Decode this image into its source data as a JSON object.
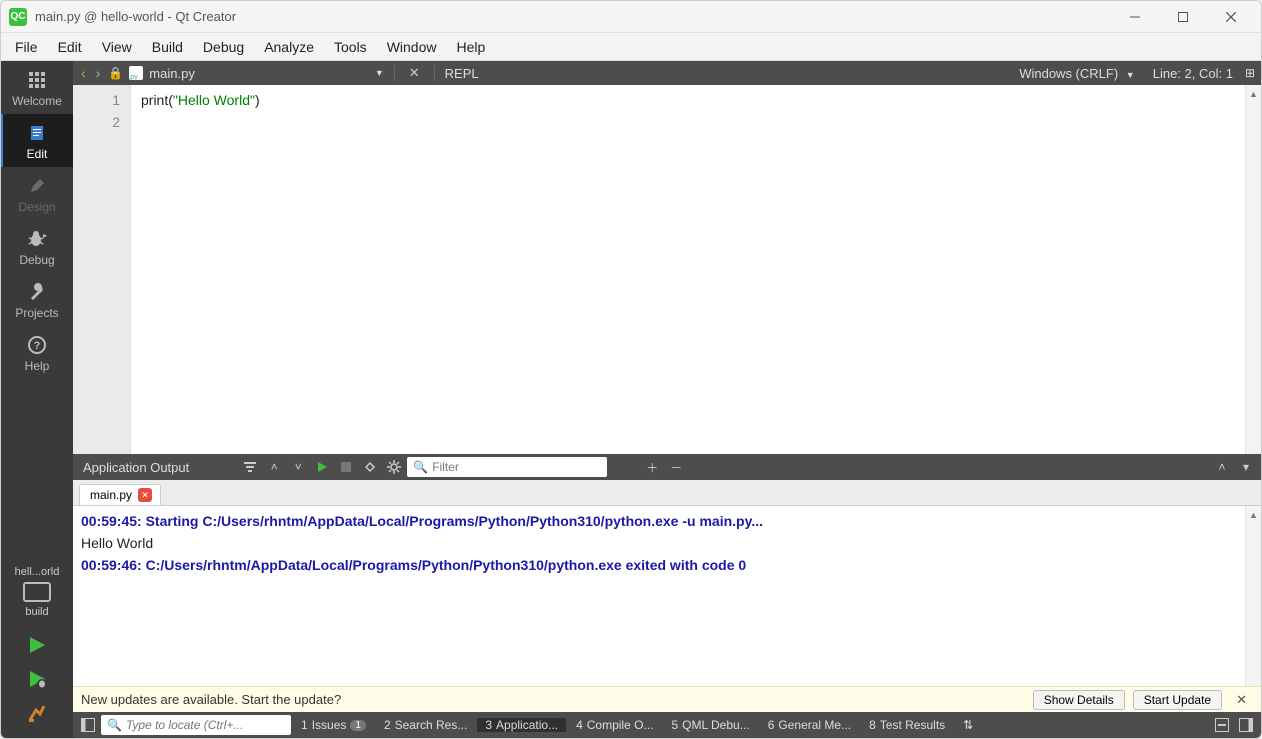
{
  "window": {
    "title": "main.py @ hello-world - Qt Creator",
    "logo_text": "QC"
  },
  "menubar": [
    "File",
    "Edit",
    "View",
    "Build",
    "Debug",
    "Analyze",
    "Tools",
    "Window",
    "Help"
  ],
  "activity": {
    "items": [
      {
        "id": "welcome",
        "label": "Welcome",
        "disabled": false
      },
      {
        "id": "edit",
        "label": "Edit",
        "active": true
      },
      {
        "id": "design",
        "label": "Design",
        "disabled": true
      },
      {
        "id": "debug",
        "label": "Debug"
      },
      {
        "id": "projects",
        "label": "Projects"
      },
      {
        "id": "help",
        "label": "Help"
      }
    ],
    "kit_label_top": "hell...orld",
    "kit_label_bottom": "build"
  },
  "editor_nav": {
    "filename": "main.py",
    "repl_label": "REPL",
    "encoding": "Windows (CRLF)",
    "cursor": "Line: 2, Col: 1"
  },
  "editor": {
    "lines": [
      {
        "num": "1",
        "fn": "print",
        "paren_open": "(",
        "str": "\"Hello World\"",
        "paren_close": ")"
      },
      {
        "num": "2"
      }
    ]
  },
  "output_panel": {
    "title": "Application Output",
    "filter_placeholder": "Filter",
    "tab_label": "main.py",
    "lines": [
      {
        "type": "meta",
        "text": "00:59:45: Starting C:/Users/rhntm/AppData/Local/Programs/Python/Python310/python.exe -u main.py..."
      },
      {
        "type": "text",
        "text": "Hello World"
      },
      {
        "type": "meta",
        "text": "00:59:46: C:/Users/rhntm/AppData/Local/Programs/Python/Python310/python.exe exited with code 0"
      }
    ]
  },
  "update_bar": {
    "message": "New updates are available. Start the update?",
    "details_btn": "Show Details",
    "start_btn": "Start Update"
  },
  "statusbar": {
    "locate_placeholder": "Type to locate (Ctrl+...",
    "items": [
      {
        "num": "1",
        "label": "Issues",
        "badge": "1"
      },
      {
        "num": "2",
        "label": "Search Res..."
      },
      {
        "num": "3",
        "label": "Applicatio...",
        "active": true
      },
      {
        "num": "4",
        "label": "Compile O..."
      },
      {
        "num": "5",
        "label": "QML Debu..."
      },
      {
        "num": "6",
        "label": "General Me..."
      },
      {
        "num": "8",
        "label": "Test Results"
      }
    ]
  }
}
